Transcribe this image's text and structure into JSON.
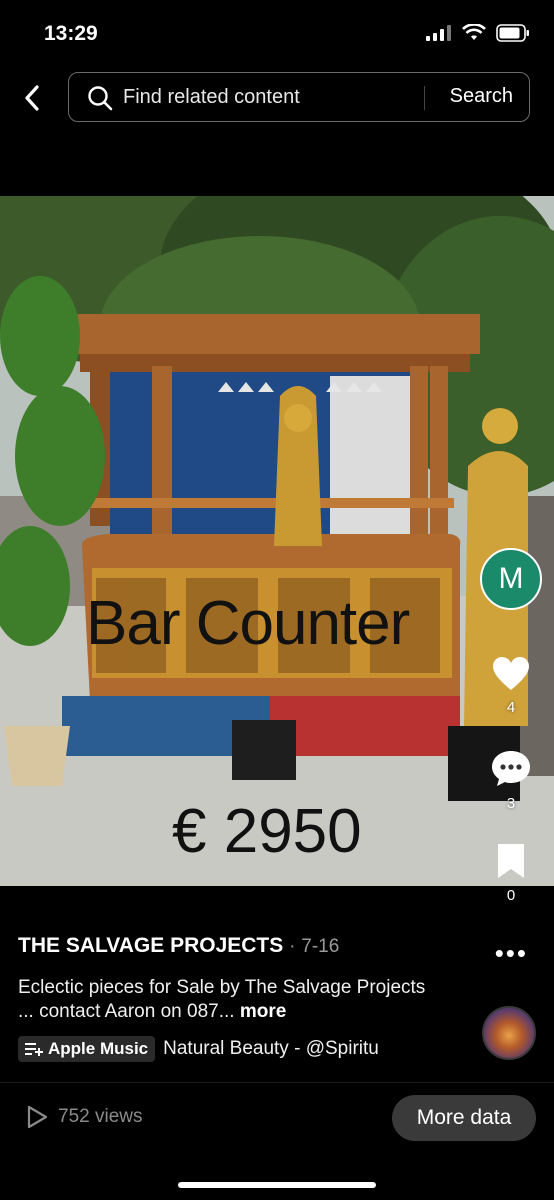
{
  "status": {
    "time": "13:29"
  },
  "search": {
    "placeholder": "Find related content",
    "button": "Search"
  },
  "post": {
    "overlay_title": "Bar Counter",
    "overlay_price": "€ 2950",
    "author": "THE SALVAGE PROJECTS",
    "separator": "·",
    "date": "7-16",
    "description": "Eclectic pieces for Sale by The Salvage Projects ... contact Aaron on 087...",
    "more_label": "more",
    "music_source": "Apple Music",
    "music_track": "Natural Beauty - @Spiritu"
  },
  "actions": {
    "avatar_letter": "M",
    "likes": "4",
    "comments": "3",
    "saves": "0"
  },
  "footer": {
    "views": "752 views",
    "more_data": "More data"
  }
}
